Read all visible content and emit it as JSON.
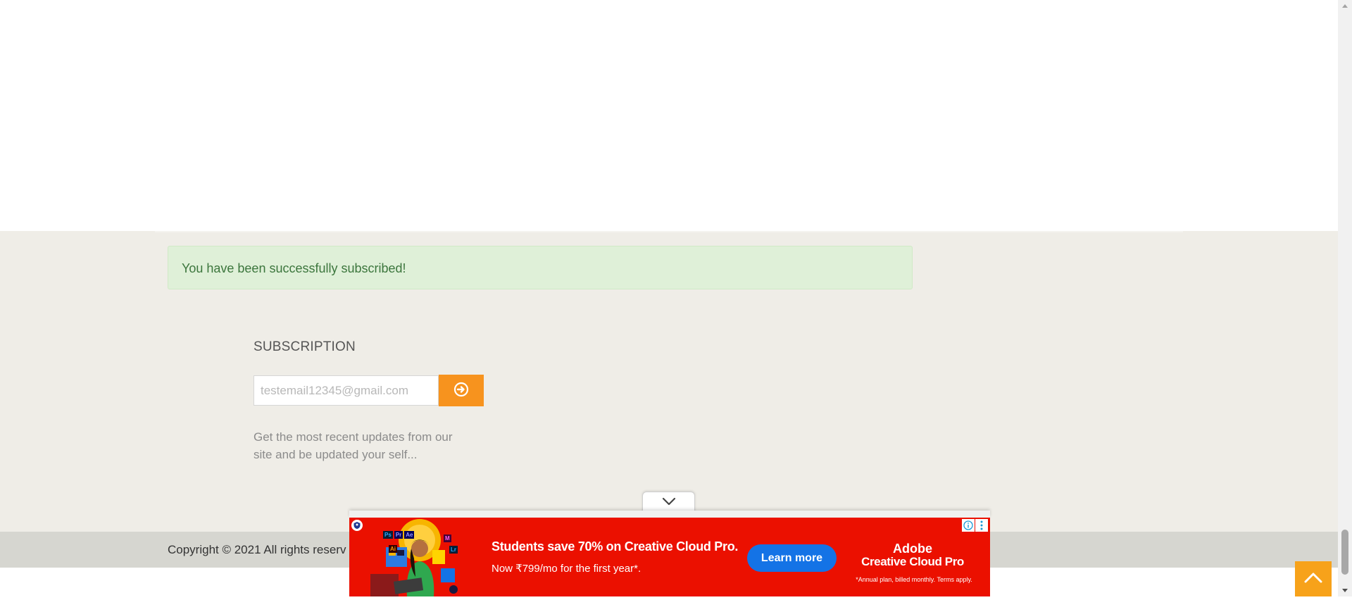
{
  "alert": {
    "message": "You have been successfully subscribed!"
  },
  "subscription": {
    "title": "SUBSCRIPTION",
    "email_placeholder": "testemail12345@gmail.com",
    "description": "Get the most recent updates from our site and be updated your self...",
    "button_icon": "arrow-circle-right-icon"
  },
  "footer": {
    "copyright": "Copyright © 2021 All rights reserv"
  },
  "ad": {
    "headline": "Students save 70% on Creative Cloud Pro.",
    "subline": "Now ₹799/mo for the first year*.",
    "cta": "Learn more",
    "brand_line1": "Adobe",
    "brand_line2": "Creative Cloud Pro",
    "fine_print": "*Annual plan, billed monthly. Terms apply.",
    "app_badges": [
      "Ps",
      "Pr",
      "Ae",
      "Ai",
      "M",
      "Lr"
    ]
  },
  "colors": {
    "accent_orange": "#f7931e",
    "ad_red": "#eb1000",
    "ad_blue": "#1473e6",
    "alert_green_bg": "#dff0d8",
    "alert_green_text": "#3c763d"
  }
}
